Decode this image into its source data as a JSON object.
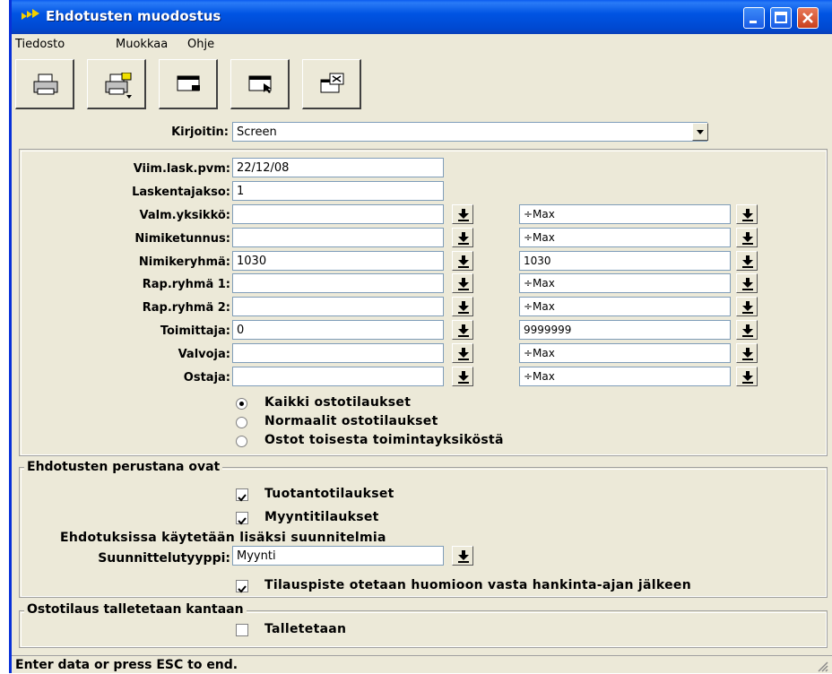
{
  "window": {
    "title": "Ehdotusten muodostus"
  },
  "menu": [
    "Tiedosto",
    "Muokkaa",
    "Ohje"
  ],
  "toolbar": [
    {
      "icon": "printer-icon"
    },
    {
      "icon": "printer-setup-icon"
    },
    {
      "icon": "window-minimize-icon"
    },
    {
      "icon": "window-cursor-icon"
    },
    {
      "icon": "window-close-icon"
    }
  ],
  "printer": {
    "label": "Kirjoitin:",
    "value": "Screen"
  },
  "form": {
    "viim_lask": {
      "label": "Viim.lask.pvm:",
      "value": "22/12/08"
    },
    "laskentajakso": {
      "label": "Laskentajakso:",
      "value": "1"
    },
    "ranges": [
      {
        "label": "Valm.yksikkö:",
        "from": "",
        "to": "÷Max"
      },
      {
        "label": "Nimiketunnus:",
        "from": "",
        "to": "÷Max"
      },
      {
        "label": "Nimikeryhmä:",
        "from": "1030",
        "to": "1030"
      },
      {
        "label": "Rap.ryhmä 1:",
        "from": "",
        "to": "÷Max"
      },
      {
        "label": "Rap.ryhmä 2:",
        "from": "",
        "to": "÷Max"
      },
      {
        "label": "Toimittaja:",
        "from": "0",
        "to": "9999999"
      },
      {
        "label": "Valvoja:",
        "from": "",
        "to": "÷Max"
      },
      {
        "label": "Ostaja:",
        "from": "",
        "to": "÷Max"
      }
    ],
    "radios": [
      {
        "label": "Kaikki ostotilaukset",
        "selected": true
      },
      {
        "label": "Normaalit ostotilaukset",
        "selected": false
      },
      {
        "label": "Ostot toisesta toimintayksiköstä",
        "selected": false
      }
    ]
  },
  "basis_group": {
    "title": "Ehdotusten perustana ovat",
    "checks": [
      {
        "label": "Tuotantotilaukset",
        "checked": true
      },
      {
        "label": "Myyntitilaukset",
        "checked": true
      }
    ],
    "plans_note": "Ehdotuksissa käytetään lisäksi suunnitelmia",
    "plan_type": {
      "label": "Suunnittelutyyppi:",
      "value": "Myynti"
    },
    "reorder_check": {
      "label": "Tilauspiste otetaan huomioon vasta hankinta-ajan jälkeen",
      "checked": true
    }
  },
  "save_group": {
    "title": "Ostotilaus talletetaan kantaan",
    "check": {
      "label": "Talletetaan",
      "checked": false
    }
  },
  "status": "Enter data or press ESC to end."
}
